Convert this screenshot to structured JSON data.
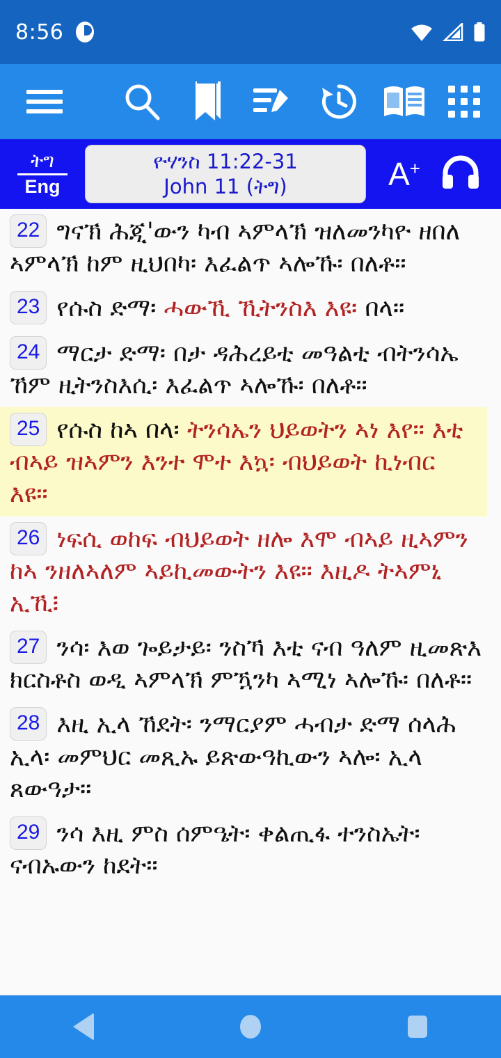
{
  "status_bar": {
    "time": "8:56",
    "notification_icon": "app-notification-icon",
    "wifi_icon": "wifi-icon",
    "signal_icon": "cellular-signal-icon",
    "battery_icon": "battery-full-icon",
    "background_color": "#1565C0"
  },
  "toolbar": {
    "background_color": "#2489E8",
    "items": [
      {
        "name": "menu-button",
        "icon": "hamburger-menu-icon"
      },
      {
        "name": "search-button",
        "icon": "search-icon"
      },
      {
        "name": "bookmark-button",
        "icon": "bookmark-icon"
      },
      {
        "name": "notes-button",
        "icon": "note-edit-icon"
      },
      {
        "name": "history-button",
        "icon": "history-clock-icon"
      },
      {
        "name": "read-button",
        "icon": "open-book-icon"
      },
      {
        "name": "apps-button",
        "icon": "grid-apps-icon"
      }
    ]
  },
  "navbar": {
    "background_color": "#1414F0",
    "language_toggle": {
      "top": "ትግ",
      "bottom": "Eng"
    },
    "reference": {
      "line1": "ዮሃንስ  11:22-31",
      "line2": "John  11 (ትግ)",
      "text_color": "#1A1ACC",
      "background_color": "#EDEDED"
    },
    "font_size_button": {
      "letter": "A",
      "plus": "+"
    },
    "audio_button_icon": "headphones-icon"
  },
  "reader": {
    "background_color": "#FAFAFA",
    "highlight_color": "#FCFAC8",
    "red_text_color": "#B22222",
    "black_text_color": "#111111",
    "verse_number_color": "#1A1AE6",
    "verses": [
      {
        "number": "22",
        "highlighted": false,
        "segments": [
          {
            "color": "black",
            "text": "ግናኽ ሕጂ'ውን ካብ ኣምላኽ ዝለመንካዮ ዘበለ ኣምላኽ ከም ዚህበካ፡ እፈልጥ ኣሎኹ፡ በለቶ።"
          }
        ]
      },
      {
        "number": "23",
        "highlighted": false,
        "segments": [
          {
            "color": "black",
            "text": "የሱስ ድማ፡ "
          },
          {
            "color": "red",
            "text": "ሓውኺ ኺትንስእ እዩ፡ "
          },
          {
            "color": "black",
            "text": "በላ።"
          }
        ]
      },
      {
        "number": "24",
        "highlighted": false,
        "segments": [
          {
            "color": "black",
            "text": "ማርታ ድማ፡ በታ ዳሕረይቲ መዓልቲ ብትንሳኤ ኸም ዚትንስእሲ፡ እፈልጥ ኣሎኹ፡ በለቶ።"
          }
        ]
      },
      {
        "number": "25",
        "highlighted": true,
        "segments": [
          {
            "color": "black",
            "text": "የሱስ ከኣ በላ፡ "
          },
          {
            "color": "red",
            "text": "ትንሳኤን ህይወትን ኣነ እየ። እቲ ብኣይ ዝኣምን እንተ ሞተ እኳ፡ ብህይወት ኪነብር እዩ።"
          }
        ]
      },
      {
        "number": "26",
        "highlighted": false,
        "segments": [
          {
            "color": "red",
            "text": "ነፍሲ ወከፍ ብህይወት ዘሎ እሞ ብኣይ ዚኣምን ከኣ ንዘለኣለም ኣይኪመውትን እዩ። እዚዶ ትኣምኒ ኢኺ፧"
          }
        ]
      },
      {
        "number": "27",
        "highlighted": false,
        "segments": [
          {
            "color": "black",
            "text": "ንሳ፡ እወ ጐይታይ፡ ንስኻ እቲ ናብ ዓለም ዚመጽእ ክርስቶስ ወዲ ኣምላኽ ምዃንካ ኣሚነ ኣሎኹ፡ በለቶ።"
          }
        ]
      },
      {
        "number": "28",
        "highlighted": false,
        "segments": [
          {
            "color": "black",
            "text": "እዚ ኢላ ኸደት፡ ንማርያም ሓብታ ድማ ሰላሕ ኢላ፡ መምህር መጺኡ ይጽውዓኪውን ኣሎ፡ ኢላ ጸውዓታ።"
          }
        ]
      },
      {
        "number": "29",
        "highlighted": false,
        "segments": [
          {
            "color": "black",
            "text": "ንሳ እዚ ምስ ሰምዔት፡ ቀልጢፋ ተንስኤት፡ ናብኡውን ከደት።"
          }
        ]
      }
    ]
  },
  "system_nav": {
    "background_color": "#2489E8",
    "icon_color": "#AFD2F4",
    "back_icon": "back-triangle-icon",
    "home_icon": "home-circle-icon",
    "recents_icon": "recents-square-icon"
  }
}
